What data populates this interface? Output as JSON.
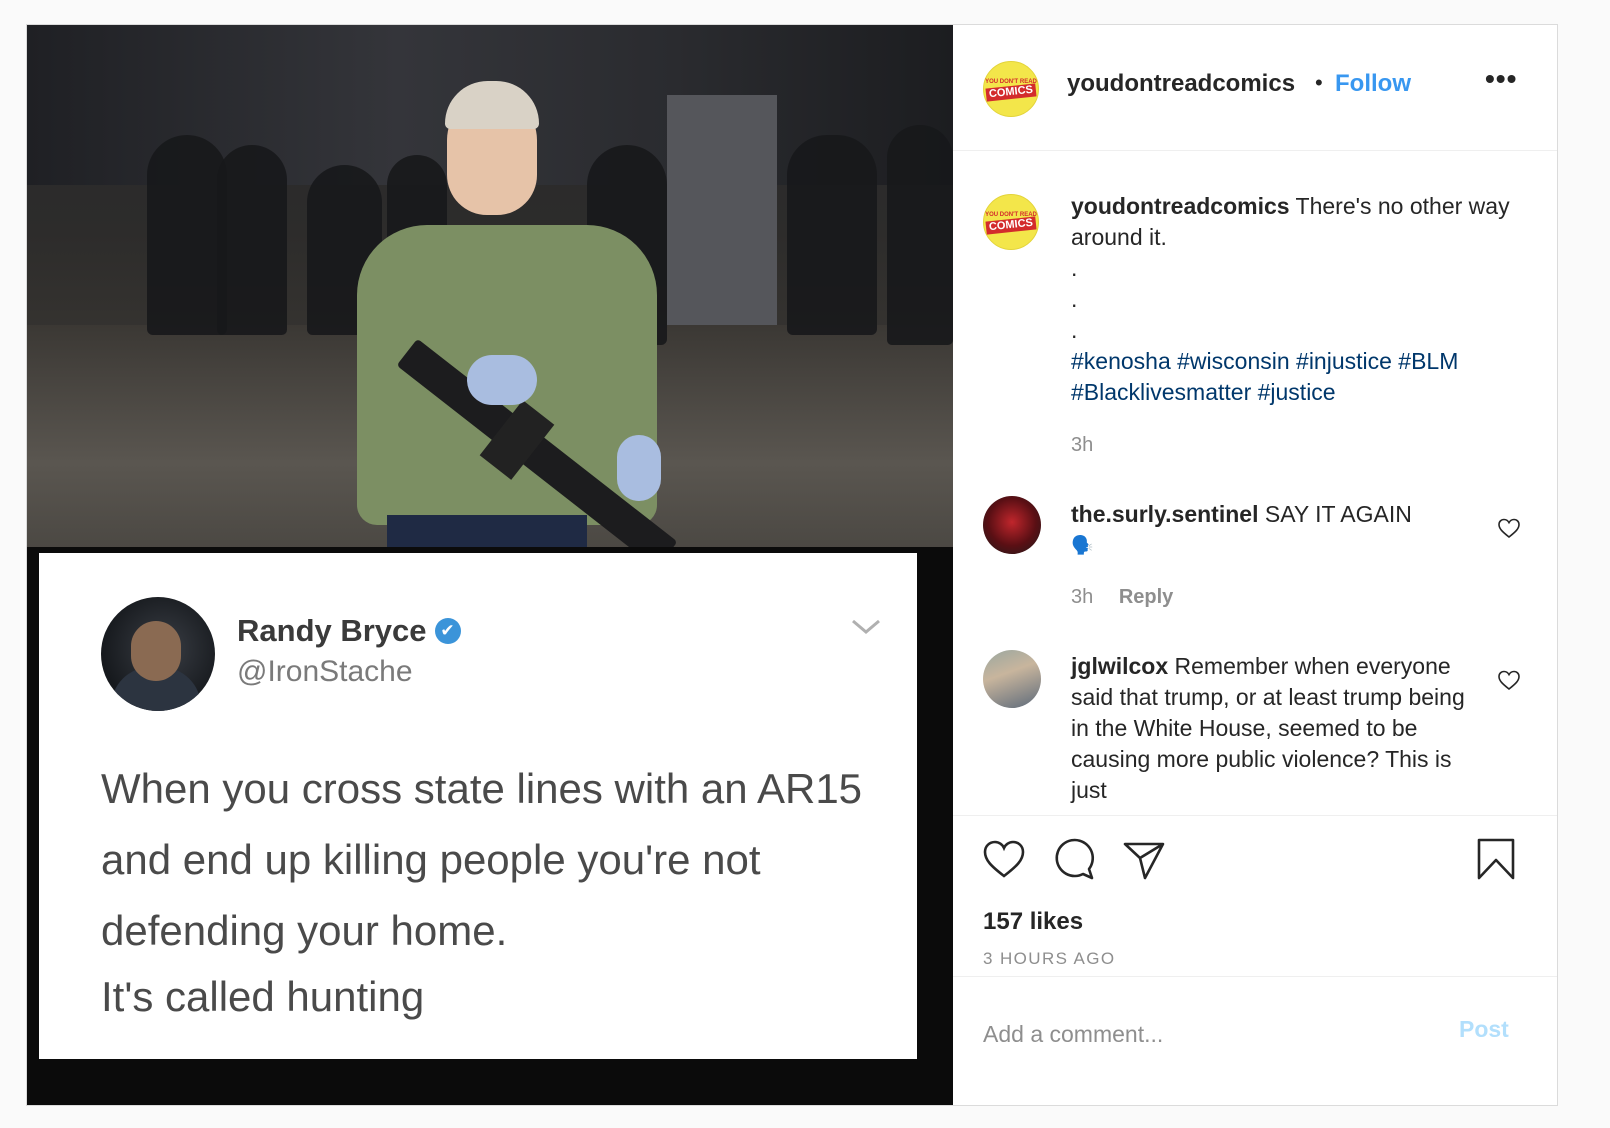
{
  "post": {
    "media": {
      "tweet": {
        "name": "Randy Bryce",
        "handle": "@IronStache",
        "verified_mark": "✔",
        "text": "When you cross state lines with an AR15 and end up killing people you're not defending your home.",
        "text2": "It's called hunting"
      }
    },
    "header": {
      "username": "youdontreadcomics",
      "separator": "•",
      "follow_label": "Follow",
      "more_label": "•••"
    },
    "logo": {
      "top_text": "YOU DON'T READ",
      "main_text": "COMICS"
    },
    "caption": {
      "username": "youdontreadcomics",
      "text": "There's no other way around it.",
      "dots": [
        ".",
        ".",
        "."
      ],
      "hashtags": "#kenosha #wisconsin #injustice #BLM #Blacklivesmatter #justice",
      "time": "3h"
    },
    "comments": [
      {
        "username": "the.surly.sentinel",
        "text": "SAY IT AGAIN",
        "emoji": "🗣️",
        "time": "3h",
        "reply_label": "Reply"
      },
      {
        "username": "jglwilcox",
        "text": "Remember when everyone said that trump, or at least trump being in the White House, seemed to be causing more public violence? This is just"
      }
    ],
    "likes": "157 likes",
    "time_ago": "3 HOURS AGO",
    "add_comment": {
      "placeholder": "Add a comment...",
      "post_label": "Post"
    },
    "colors": {
      "link": "#3897f0",
      "hashtag": "#00376b",
      "muted": "#8e8e8e",
      "post_disabled": "#b2dffc"
    }
  }
}
